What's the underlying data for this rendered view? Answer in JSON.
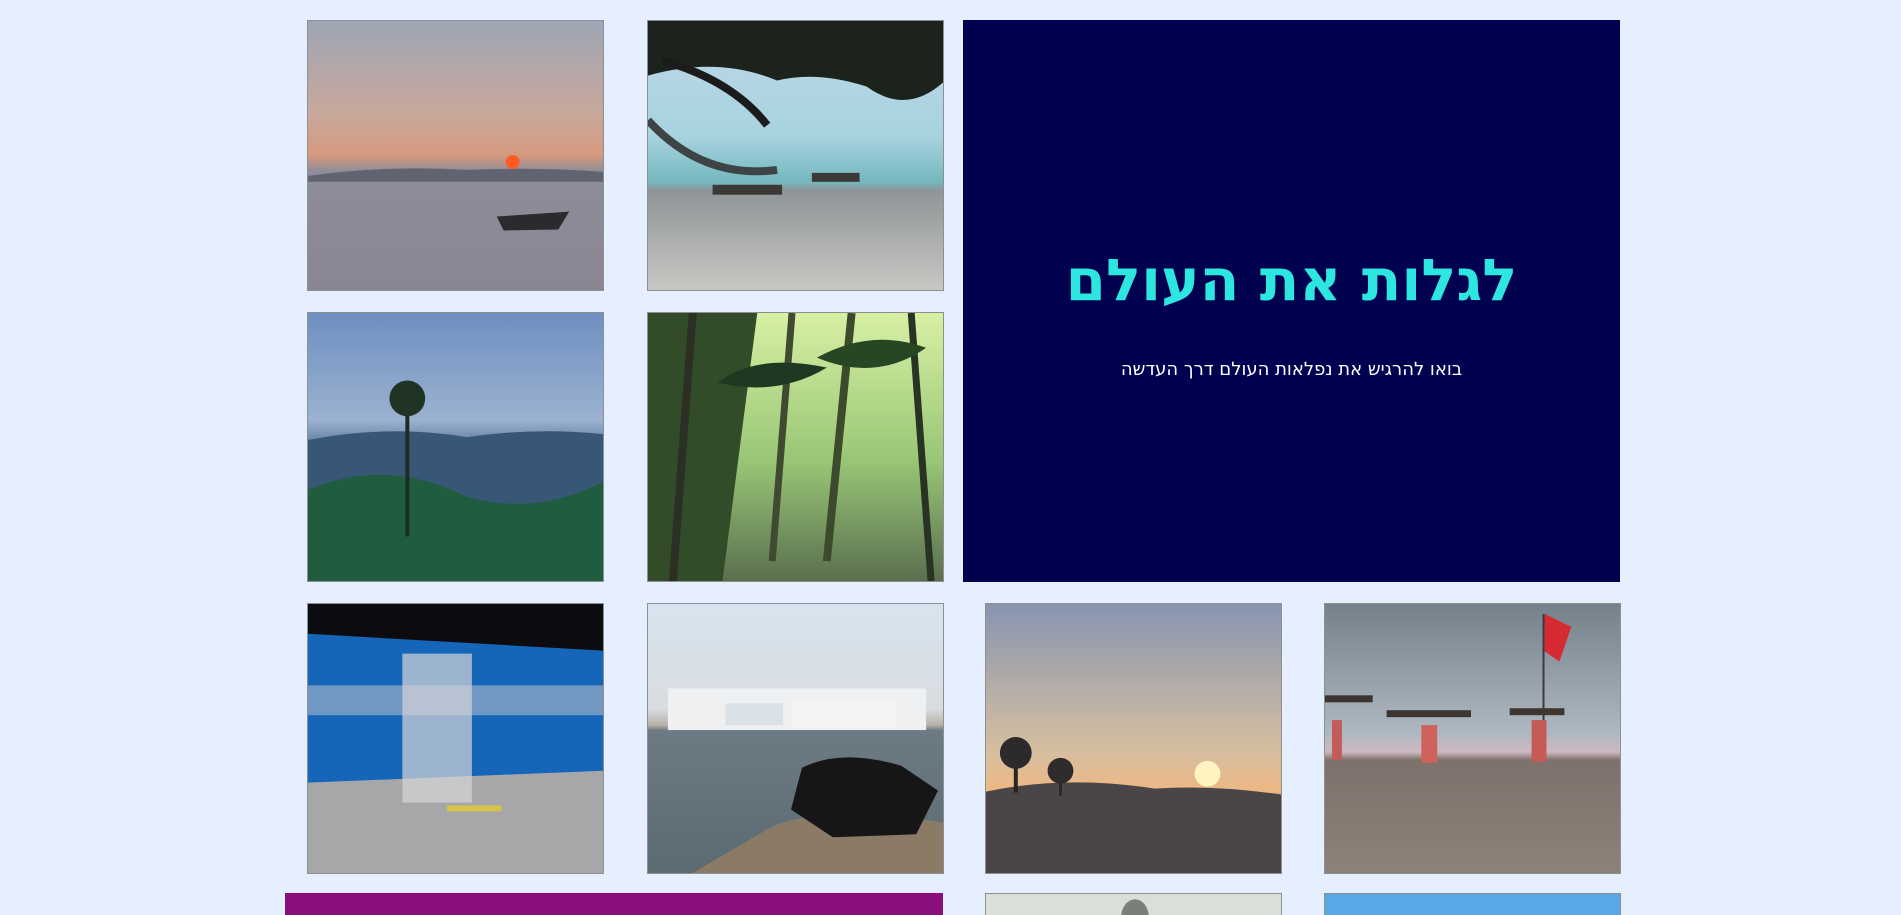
{
  "hero": {
    "title": "לגלות את העולם",
    "subtitle": "בואו להרגיש את נפלאות העולם דרך העדשה"
  },
  "gallery": [
    {
      "name": "sunset-boat-photo"
    },
    {
      "name": "beach-hammock-photo"
    },
    {
      "name": "misty-mountain-photo"
    },
    {
      "name": "palm-forest-photo"
    },
    {
      "name": "blurred-train-photo"
    },
    {
      "name": "lake-cow-photo"
    },
    {
      "name": "sunset-shore-photo"
    },
    {
      "name": "beach-people-photo"
    }
  ],
  "colors": {
    "page_background": "#e6efff",
    "hero_background": "#000050",
    "hero_title": "#2ee6e0",
    "hero_subtitle": "#ffffff",
    "footer_block": "#8a0f7a"
  }
}
